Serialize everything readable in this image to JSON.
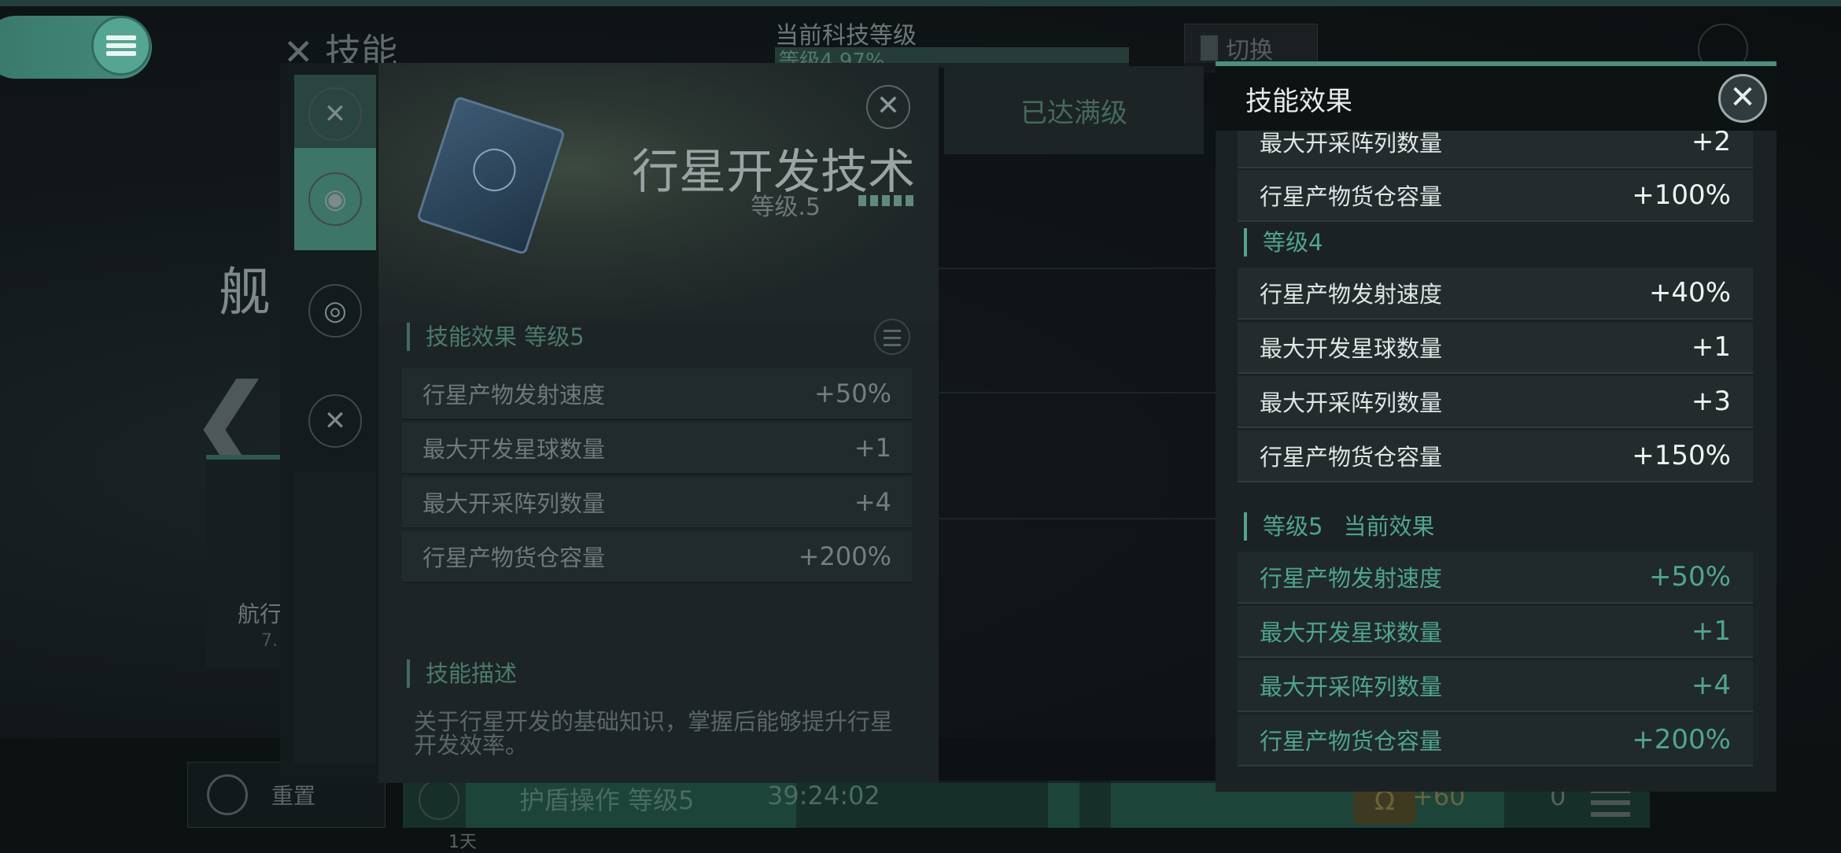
{
  "background": {
    "page_title": "技能",
    "tech_level_label": "当前科技等级",
    "tech_level_value": "等级4 97%",
    "switch_label": "切换",
    "ship_title": "舰",
    "ship_card_label": "航行",
    "ship_card_value": "7.",
    "max_level_label": "已达满级",
    "reset_label": "重置",
    "research_name": "护盾操作 等级5",
    "research_time": "39:24:02",
    "research_day": "1天",
    "resource_omega_value": "+60",
    "resource_other_value": "0",
    "colors": {
      "accent": "#4fa58e",
      "brand": "#55a593"
    },
    "icons": {
      "menu": "hamburger-menu-icon",
      "left": "chevron-left-icon",
      "reset": "reset-icon"
    }
  },
  "skill_detail": {
    "name": "行星开发技术",
    "level_text": "等级.5",
    "level_dots": 5,
    "effects_heading": "技能效果 等级5",
    "effects": [
      {
        "label": "行星产物发射速度",
        "value": "+50%"
      },
      {
        "label": "最大开发星球数量",
        "value": "+1"
      },
      {
        "label": "最大开采阵列数量",
        "value": "+4"
      },
      {
        "label": "行星产物货仓容量",
        "value": "+200%"
      }
    ],
    "description_heading": "技能描述",
    "description": "关于行星开发的基础知识，掌握后能够提升行星开发效率。",
    "close_symbol": "✕"
  },
  "effect_popup": {
    "title": "技能效果",
    "close_symbol": "✕",
    "partial_top_row": {
      "label": "最大开采阵列数量",
      "value": "+2"
    },
    "level3_tail": [
      {
        "label": "行星产物货仓容量",
        "value": "+100%"
      }
    ],
    "level4": {
      "heading": "等级4",
      "rows": [
        {
          "label": "行星产物发射速度",
          "value": "+40%"
        },
        {
          "label": "最大开发星球数量",
          "value": "+1"
        },
        {
          "label": "最大开采阵列数量",
          "value": "+3"
        },
        {
          "label": "行星产物货仓容量",
          "value": "+150%"
        }
      ]
    },
    "level5": {
      "heading": "等级5",
      "current_tag": "当前效果",
      "rows": [
        {
          "label": "行星产物发射速度",
          "value": "+50%"
        },
        {
          "label": "最大开发星球数量",
          "value": "+1"
        },
        {
          "label": "最大开采阵列数量",
          "value": "+4"
        },
        {
          "label": "行星产物货仓容量",
          "value": "+200%"
        }
      ]
    }
  }
}
